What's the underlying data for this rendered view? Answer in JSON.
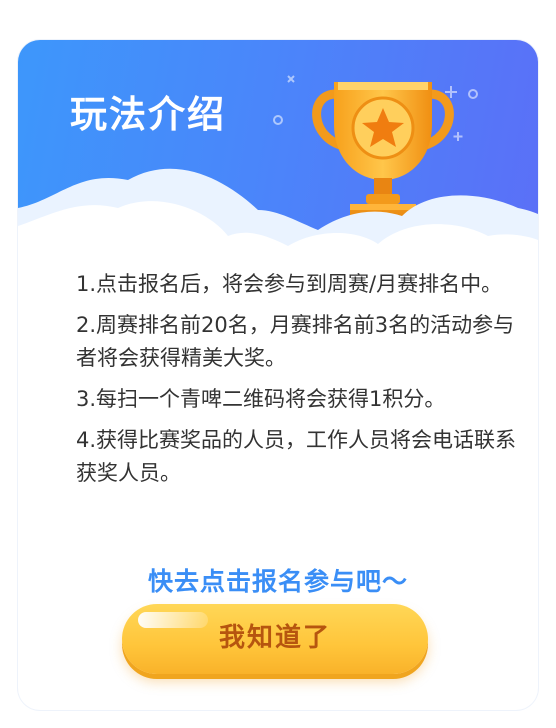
{
  "modal": {
    "title": "玩法介绍",
    "trophy_icon": "trophy-icon",
    "rules": [
      "1.点击报名后，将会参与到周赛/月赛排名中。",
      "2.周赛排名前20名，月赛排名前3名的活动参与者将会获得精美大奖。",
      "3.每扫一个青啤二维码将会获得1积分。",
      "4.获得比赛奖品的人员，工作人员将会电话联系获奖人员。"
    ],
    "cta_text": "快去点击报名参与吧～",
    "confirm_label": "我知道了"
  },
  "colors": {
    "header_gradient_start": "#3d97fb",
    "header_gradient_end": "#5b6ff7",
    "cta_text": "#3a8ef6",
    "button_yellow": "#ffc53a",
    "button_label": "#b6550f",
    "rule_text": "#333333"
  }
}
